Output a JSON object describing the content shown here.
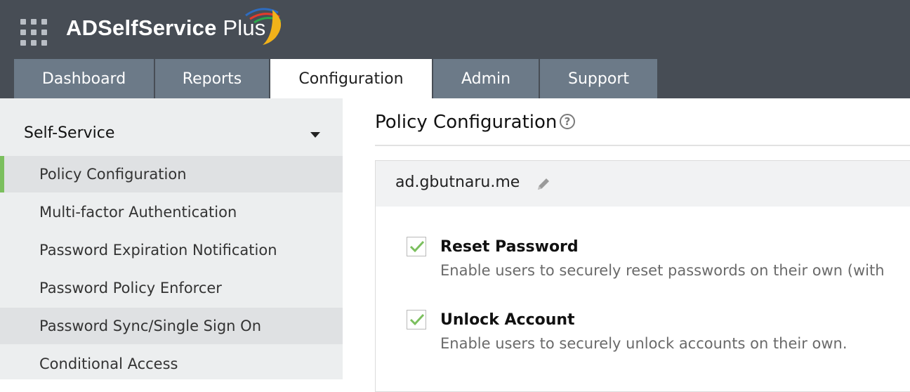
{
  "app": {
    "name_bold": "ADSelfService",
    "name_light": " Plus",
    "logo_colors": [
      "#2e6cc0",
      "#e43b2c",
      "#2aa84a",
      "#f2b21a"
    ]
  },
  "nav": {
    "tabs": [
      {
        "label": "Dashboard",
        "active": false
      },
      {
        "label": "Reports",
        "active": false
      },
      {
        "label": "Configuration",
        "active": true
      },
      {
        "label": "Admin",
        "active": false
      },
      {
        "label": "Support",
        "active": false
      }
    ]
  },
  "sidebar": {
    "section": "Self-Service",
    "items": [
      {
        "label": "Policy Configuration",
        "selected": true
      },
      {
        "label": "Multi-factor Authentication"
      },
      {
        "label": "Password Expiration Notification"
      },
      {
        "label": "Password Policy Enforcer"
      },
      {
        "label": "Password Sync/Single Sign On"
      },
      {
        "label": "Conditional Access"
      }
    ]
  },
  "main": {
    "title": "Policy Configuration",
    "help_icon": "?",
    "domain": "ad.gbutnaru.me",
    "options": [
      {
        "title": "Reset Password",
        "description": "Enable users to securely reset passwords on their own (with",
        "checked": true
      },
      {
        "title": "Unlock Account",
        "description": "Enable users to securely unlock accounts on their own.",
        "checked": true
      }
    ]
  },
  "colors": {
    "header_bg": "#474d55",
    "tab_bg": "#6c7a88",
    "sidebar_bg": "#eceeef",
    "selected_accent": "#7bbf5e",
    "checkmark": "#7bbf5e"
  }
}
